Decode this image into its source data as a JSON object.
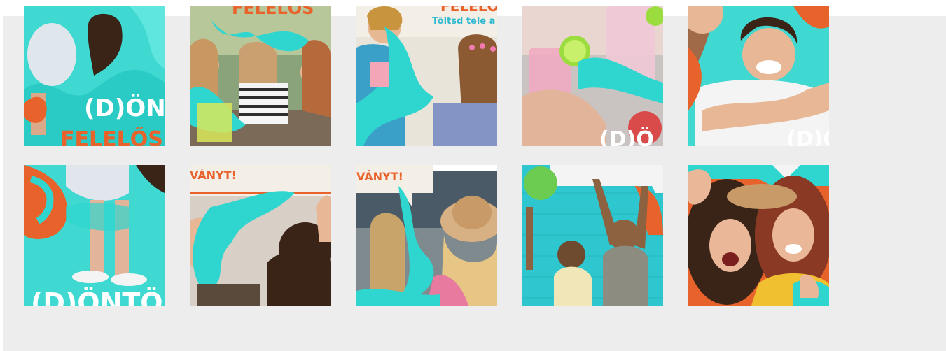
{
  "gallery": {
    "colors": {
      "panel_bg": "#ededed",
      "teal": "#2fd6cf",
      "teal_light": "#52e3da",
      "orange": "#e8622c",
      "cream": "#f4efe6"
    },
    "thumbnails": [
      {
        "id": "thumb-1",
        "text_primary": "(D)ÖN",
        "text_secondary": "FELELŐS"
      },
      {
        "id": "thumb-2",
        "text_primary": "FELELŐS"
      },
      {
        "id": "thumb-3",
        "text_primary": "FELELŐ",
        "text_secondary": "Töltsd tele a"
      },
      {
        "id": "thumb-4",
        "text_primary": "(D)Ö"
      },
      {
        "id": "thumb-5",
        "text_primary": "(D)Ö"
      },
      {
        "id": "thumb-6",
        "text_primary": "(D)ÖNTÖ"
      },
      {
        "id": "thumb-7",
        "text_primary": "VÁNYT!"
      },
      {
        "id": "thumb-8",
        "text_primary": "VÁNYT!"
      },
      {
        "id": "thumb-9"
      },
      {
        "id": "thumb-10"
      }
    ]
  }
}
